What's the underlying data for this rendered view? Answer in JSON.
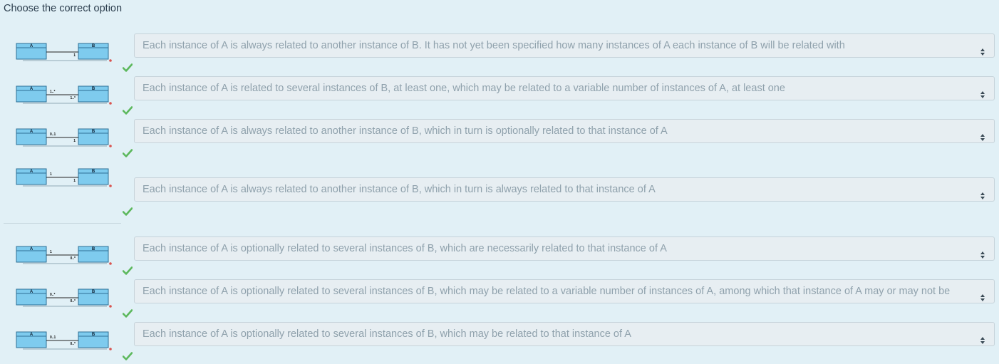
{
  "question": {
    "prompt": "Choose the correct option"
  },
  "items": [
    {
      "diagram": {
        "class_a": "A",
        "class_b": "B",
        "mult_a": "",
        "mult_b": "1"
      },
      "answer": "Each instance of A is always related to another instance of B. It has not yet been specified how many instances of A each instance of B will be related with"
    },
    {
      "diagram": {
        "class_a": "A",
        "class_b": "B",
        "mult_a": "1..*",
        "mult_b": "1..*"
      },
      "answer": "Each instance of A is related to several instances of B, at least one, which may be related to a variable number of instances of A, at least one"
    },
    {
      "diagram": {
        "class_a": "A",
        "class_b": "B",
        "mult_a": "0..1",
        "mult_b": "1"
      },
      "answer": "Each instance of A is always related to another instance of B, which in turn is optionally related to that instance of A"
    },
    {
      "diagram": {
        "class_a": "A",
        "class_b": "B",
        "mult_a": "1",
        "mult_b": "1"
      },
      "answer": "Each instance of A is always related to another instance of B, which in turn is always related to that instance of A"
    },
    {
      "diagram": {
        "class_a": "A",
        "class_b": "B",
        "mult_a": "1",
        "mult_b": "0..*"
      },
      "answer": "Each instance of A is optionally related to several instances of B, which are necessarily related to that instance of A"
    },
    {
      "diagram": {
        "class_a": "A",
        "class_b": "B",
        "mult_a": "0..*",
        "mult_b": "0..*"
      },
      "answer": "Each instance of A is optionally related to several instances of B, which may be related to a variable number of instances of A, among which that instance of A may or may not be"
    },
    {
      "diagram": {
        "class_a": "A",
        "class_b": "B",
        "mult_a": "0..1",
        "mult_b": "0..*"
      },
      "answer": "Each instance of A is optionally related to several instances of B, which may be related to that instance of A"
    }
  ],
  "icons": {
    "status": "checkmark-icon",
    "select": "select-arrows-icon"
  },
  "colors": {
    "background": "#e1f0f6",
    "check": "#5cb85c",
    "class_box": "#7ecbee",
    "text_muted": "#8fa1ac"
  }
}
